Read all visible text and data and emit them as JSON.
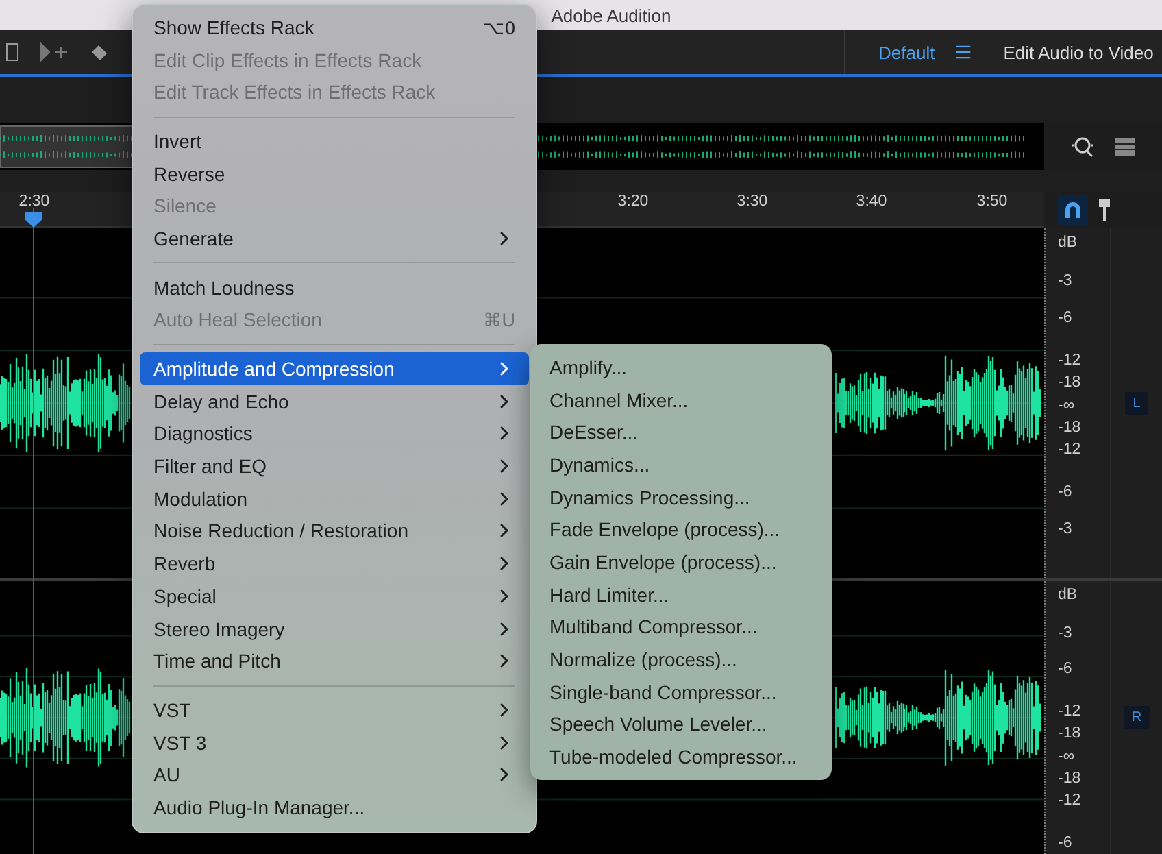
{
  "window": {
    "title": "Adobe Audition"
  },
  "toolbar": {
    "workspace": {
      "label": "Default",
      "selected": true
    },
    "workspace_button": "Edit Audio to Video"
  },
  "ruler": {
    "playhead": "2:30",
    "ticks": [
      "3:20",
      "3:30",
      "3:40",
      "3:50"
    ]
  },
  "channels": [
    {
      "label": "L",
      "scale": [
        "dB",
        "-3",
        "-6",
        "-12",
        "-18",
        "-∞",
        "-18",
        "-12",
        "-6",
        "-3"
      ]
    },
    {
      "label": "R",
      "scale": [
        "dB",
        "-3",
        "-6",
        "-12",
        "-18",
        "-∞",
        "-18",
        "-12",
        "-6"
      ]
    }
  ],
  "menu": {
    "items": [
      {
        "kind": "item",
        "label": "Show Effects Rack",
        "shortcut": "⌥0",
        "disabled": false,
        "submenu": false,
        "selected": false
      },
      {
        "kind": "item",
        "label": "Edit Clip Effects in Effects Rack",
        "disabled": true,
        "submenu": false,
        "selected": false
      },
      {
        "kind": "item",
        "label": "Edit Track Effects in Effects Rack",
        "disabled": true,
        "submenu": false,
        "selected": false
      },
      {
        "kind": "separator"
      },
      {
        "kind": "item",
        "label": "Invert",
        "disabled": false,
        "submenu": false,
        "selected": false
      },
      {
        "kind": "item",
        "label": "Reverse",
        "disabled": false,
        "submenu": false,
        "selected": false
      },
      {
        "kind": "item",
        "label": "Silence",
        "disabled": true,
        "submenu": false,
        "selected": false
      },
      {
        "kind": "item",
        "label": "Generate",
        "disabled": false,
        "submenu": true,
        "selected": false
      },
      {
        "kind": "separator"
      },
      {
        "kind": "item",
        "label": "Match Loudness",
        "disabled": false,
        "submenu": false,
        "selected": false
      },
      {
        "kind": "item",
        "label": "Auto Heal Selection",
        "shortcut": "⌘U",
        "disabled": true,
        "submenu": false,
        "selected": false
      },
      {
        "kind": "separator"
      },
      {
        "kind": "item",
        "label": "Amplitude and Compression",
        "disabled": false,
        "submenu": true,
        "selected": true
      },
      {
        "kind": "item",
        "label": "Delay and Echo",
        "disabled": false,
        "submenu": true,
        "selected": false
      },
      {
        "kind": "item",
        "label": "Diagnostics",
        "disabled": false,
        "submenu": true,
        "selected": false
      },
      {
        "kind": "item",
        "label": "Filter and EQ",
        "disabled": false,
        "submenu": true,
        "selected": false
      },
      {
        "kind": "item",
        "label": "Modulation",
        "disabled": false,
        "submenu": true,
        "selected": false
      },
      {
        "kind": "item",
        "label": "Noise Reduction / Restoration",
        "disabled": false,
        "submenu": true,
        "selected": false
      },
      {
        "kind": "item",
        "label": "Reverb",
        "disabled": false,
        "submenu": true,
        "selected": false
      },
      {
        "kind": "item",
        "label": "Special",
        "disabled": false,
        "submenu": true,
        "selected": false
      },
      {
        "kind": "item",
        "label": "Stereo Imagery",
        "disabled": false,
        "submenu": true,
        "selected": false
      },
      {
        "kind": "item",
        "label": "Time and Pitch",
        "disabled": false,
        "submenu": true,
        "selected": false
      },
      {
        "kind": "separator"
      },
      {
        "kind": "item",
        "label": "VST",
        "disabled": false,
        "submenu": true,
        "selected": false
      },
      {
        "kind": "item",
        "label": "VST 3",
        "disabled": false,
        "submenu": true,
        "selected": false
      },
      {
        "kind": "item",
        "label": "AU",
        "disabled": false,
        "submenu": true,
        "selected": false
      },
      {
        "kind": "item",
        "label": "Audio Plug-In Manager...",
        "disabled": false,
        "submenu": false,
        "selected": false
      }
    ]
  },
  "submenu": {
    "items": [
      "Amplify...",
      "Channel Mixer...",
      "DeEsser...",
      "Dynamics...",
      "Dynamics Processing...",
      "Fade Envelope (process)...",
      "Gain Envelope (process)...",
      "Hard Limiter...",
      "Multiband Compressor...",
      "Normalize (process)...",
      "Single-band Compressor...",
      "Speech Volume Leveler...",
      "Tube-modeled Compressor..."
    ]
  }
}
